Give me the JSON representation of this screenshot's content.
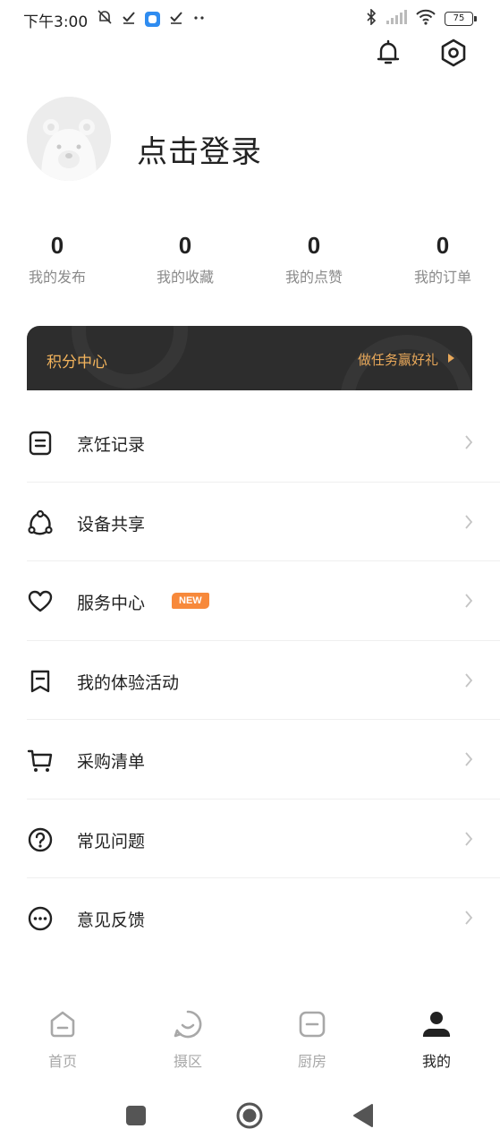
{
  "status_bar": {
    "time": "下午3:00",
    "left_icons": [
      "mute-bell-icon",
      "check-icon",
      "app-notification-icon",
      "check-icon",
      "more-dots-icon"
    ],
    "battery": "75"
  },
  "header": {
    "icons": [
      "bell-icon",
      "settings-hexagon-icon"
    ]
  },
  "profile": {
    "login_text": "点击登录",
    "avatar_icon": "polar-bear-avatar"
  },
  "stats": [
    {
      "value": "0",
      "label": "我的发布"
    },
    {
      "value": "0",
      "label": "我的收藏"
    },
    {
      "value": "0",
      "label": "我的点赞"
    },
    {
      "value": "0",
      "label": "我的订单"
    }
  ],
  "points_banner": {
    "title": "积分中心",
    "action": "做任务赢好礼",
    "colors": {
      "background": "#2d2d2d",
      "text": "#f2b35c"
    }
  },
  "menu": [
    {
      "label": "烹饪记录",
      "icon": "record-list-icon"
    },
    {
      "label": "设备共享",
      "icon": "share-nodes-icon"
    },
    {
      "label": "服务中心",
      "icon": "heart-icon",
      "badge": "NEW"
    },
    {
      "label": "我的体验活动",
      "icon": "bookmark-icon"
    },
    {
      "label": "采购清单",
      "icon": "cart-icon"
    },
    {
      "label": "常见问题",
      "icon": "question-icon"
    },
    {
      "label": "意见反馈",
      "icon": "chat-bubble-icon"
    }
  ],
  "tabs": [
    {
      "label": "首页",
      "icon": "home-icon",
      "active": false
    },
    {
      "label": "摄区",
      "icon": "smile-bubble-icon",
      "active": false
    },
    {
      "label": "厨房",
      "icon": "kitchen-icon",
      "active": false
    },
    {
      "label": "我的",
      "icon": "user-icon",
      "active": true
    }
  ],
  "system_nav": [
    "recents-square-icon",
    "home-circle-icon",
    "back-triangle-icon"
  ],
  "colors": {
    "accent": "#f7893b",
    "text_primary": "#222222",
    "text_secondary": "#8a8a8a",
    "tab_inactive": "#a8a8a8"
  }
}
